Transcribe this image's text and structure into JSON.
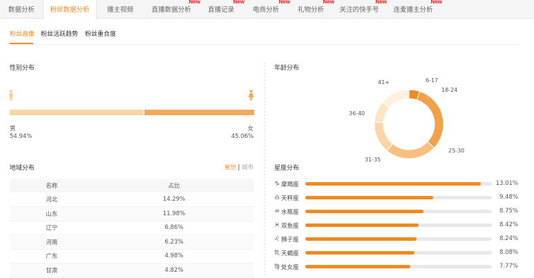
{
  "nav": {
    "tabs": [
      {
        "label": "数据分析",
        "new": false,
        "active": false
      },
      {
        "label": "粉丝数据分析",
        "new": false,
        "active": true
      },
      {
        "label": "播主视频",
        "new": false,
        "active": false
      },
      {
        "label": "直播数据分析",
        "new": true,
        "active": false
      },
      {
        "label": "直播记录",
        "new": true,
        "active": false
      },
      {
        "label": "电商分析",
        "new": true,
        "active": false
      },
      {
        "label": "礼物分析",
        "new": true,
        "active": false
      },
      {
        "label": "关注的快手号",
        "new": true,
        "active": false
      },
      {
        "label": "连麦播主分析",
        "new": true,
        "active": false
      }
    ],
    "new_badge": "New"
  },
  "subtabs": [
    "粉丝画像",
    "粉丝活跃趋势",
    "粉丝重合度"
  ],
  "gender": {
    "title": "性别分布",
    "male_label": "男",
    "female_label": "女",
    "male_pct": "54.94%",
    "female_pct": "45.06%",
    "male_value": 54.94,
    "female_value": 45.06,
    "colors": {
      "male": "#fbd6a0",
      "female": "#f3a95c"
    }
  },
  "region": {
    "title": "地域分布",
    "toggle": {
      "province": "省份",
      "separator": "|",
      "city": "城市"
    },
    "headers": {
      "name": "名称",
      "share": "占比"
    },
    "rows": [
      {
        "name": "河北",
        "share": "14.29%"
      },
      {
        "name": "山东",
        "share": "11.98%"
      },
      {
        "name": "辽宁",
        "share": "6.86%"
      },
      {
        "name": "河南",
        "share": "6.23%"
      },
      {
        "name": "广东",
        "share": "4.98%"
      },
      {
        "name": "甘肃",
        "share": "4.82%"
      }
    ]
  },
  "age": {
    "title": "年龄分布",
    "labels": [
      "6-17",
      "18-24",
      "25-30",
      "31-35",
      "36-40",
      "41+"
    ]
  },
  "chart_data": {
    "type": "pie",
    "donut": true,
    "categories": [
      "6-17",
      "18-24",
      "25-30",
      "31-35",
      "36-40",
      "41+"
    ],
    "values": [
      5,
      32,
      24,
      15,
      10,
      14
    ],
    "colors": [
      "#ef8a23",
      "#f3a04a",
      "#f8bf7e",
      "#fbd5a5",
      "#fde4c3",
      "#fef0de"
    ],
    "legend": "none"
  },
  "zodiac": {
    "title": "星座分布",
    "max": 13.01,
    "items": [
      {
        "icon": "capricorn-icon",
        "glyph": "♑",
        "name": "摩羯座",
        "pct": "13.01%",
        "value": 13.01
      },
      {
        "icon": "libra-icon",
        "glyph": "♎",
        "name": "天秤座",
        "pct": "9.48%",
        "value": 9.48
      },
      {
        "icon": "aquarius-icon",
        "glyph": "♒",
        "name": "水瓶座",
        "pct": "8.75%",
        "value": 8.75
      },
      {
        "icon": "pisces-icon",
        "glyph": "♓",
        "name": "双鱼座",
        "pct": "8.42%",
        "value": 8.42
      },
      {
        "icon": "leo-icon",
        "glyph": "♌",
        "name": "狮子座",
        "pct": "8.24%",
        "value": 8.24
      },
      {
        "icon": "scorpio-icon",
        "glyph": "♏",
        "name": "天蝎座",
        "pct": "8.08%",
        "value": 8.08
      },
      {
        "icon": "virgo-icon",
        "glyph": "♍",
        "name": "处女座",
        "pct": "7.77%",
        "value": 7.77
      }
    ],
    "bar_color": "#ef8a23"
  }
}
